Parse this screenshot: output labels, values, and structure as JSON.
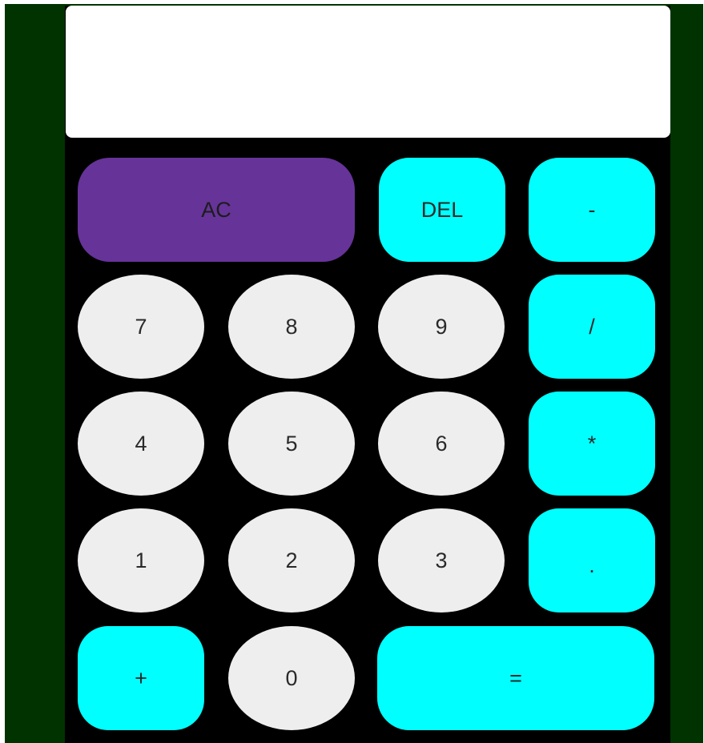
{
  "colors": {
    "page_background": "#003300",
    "calculator_body": "#000000",
    "display_background": "#ffffff",
    "number_key": "#eeeeee",
    "operator_key": "#00ffff",
    "clear_key": "#663399"
  },
  "display": {
    "value": ""
  },
  "keys": {
    "ac": "AC",
    "del": "DEL",
    "minus": "-",
    "seven": "7",
    "eight": "8",
    "nine": "9",
    "divide": "/",
    "four": "4",
    "five": "5",
    "six": "6",
    "multiply": "*",
    "one": "1",
    "two": "2",
    "three": "3",
    "decimal": ".",
    "plus": "+",
    "zero": "0",
    "equals": "="
  }
}
